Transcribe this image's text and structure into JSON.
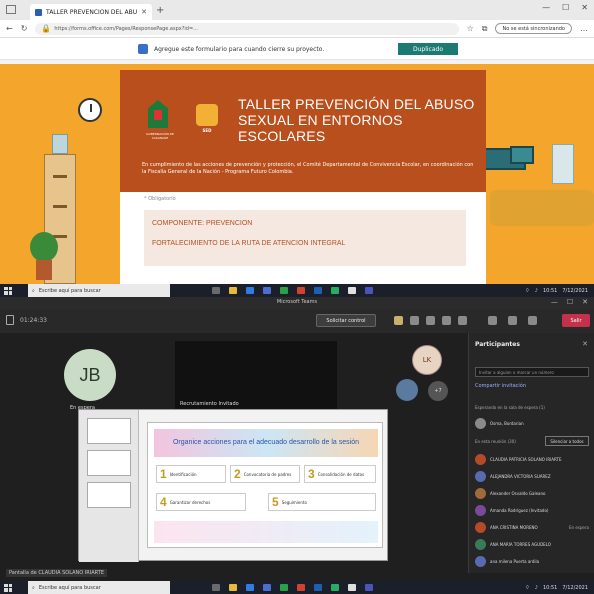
{
  "browser": {
    "tab_title": "TALLER PREVENCIÓN DEL ABU",
    "url": "https://forms.office.com/Pages/ResponsePage.aspx?id=...",
    "sync_label": "No se está sincronizando",
    "infobar_text": "Agregue este formulario para cuando cierre su proyecto.",
    "infobar_button": "Duplicado"
  },
  "form": {
    "title": "TALLER PREVENCIÓN DEL ABUSO SEXUAL EN ENTORNOS ESCOLARES",
    "description": "En cumplimiento de las acciones de prevención y protección, el Comité Departamental de Convivencia Escolar, en coordinación con la Fiscalía General de la Nación - Programa Futuro Colombia.",
    "logo1_caption": "GOBERNACIÓN DE CASANARE",
    "logo2_caption": "SED",
    "required_note": "* Obligatorio",
    "content_lines": [
      "COMPONENTE: PREVENCION",
      "FORTALECIMIENTO DE LA RUTA DE ATENCION INTEGRAL"
    ]
  },
  "taskbar": {
    "search_placeholder": "Escribe aquí para buscar",
    "time": "10:51",
    "date": "7/12/2021"
  },
  "teams": {
    "window_title": "Microsoft Teams",
    "timer": "01:24:33",
    "request_control": "Solicitar control",
    "leave": "Salir",
    "jb_initials": "JB",
    "waiting": "En espera",
    "video_name": "Recrutamiento Invitado",
    "lk_initials": "LK",
    "more_count": "+7",
    "share_caption": "Pantalla de CLAUDIA SOLANO IRIARTE",
    "slide_title": "Organice acciones para el adecuado desarrollo de la sesión",
    "steps": [
      {
        "num": "1",
        "text": "Identificación"
      },
      {
        "num": "2",
        "text": "Convocatoria de padres"
      },
      {
        "num": "3",
        "text": "Consolidación de datos"
      },
      {
        "num": "4",
        "text": "Garantizar derechos"
      },
      {
        "num": "5",
        "text": "Seguimiento"
      }
    ]
  },
  "participants": {
    "title": "Participantes",
    "search_placeholder": "Invitar a alguien o marcar un número",
    "share_link": "Compartir invitación",
    "lobby_header": "Esperando en la sala de espera (1)",
    "lobby_name": "Osma, Bordarian",
    "meeting_header": "En esta reunión (30)",
    "mute_all": "Silenciar a todos",
    "people": [
      {
        "name": "CLAUDIA PATRICIA SOLANO IRIARTE",
        "tag": "",
        "color": "#b44a2a"
      },
      {
        "name": "ALEJANDRA VICTORIA SUÁREZ",
        "tag": "",
        "color": "#5a6ab0"
      },
      {
        "name": "Alexander Osvaldo Galeano",
        "tag": "",
        "color": "#a06a3a"
      },
      {
        "name": "Amanda Rodríguez (Invitado)",
        "tag": "",
        "color": "#7a4a9a"
      },
      {
        "name": "ANA CRISTINA MORENO",
        "tag": "En espera",
        "color": "#b44a2a"
      },
      {
        "name": "ANA MARÍA TORRES AGUDELO",
        "tag": "",
        "color": "#3a7a5a"
      },
      {
        "name": "ana milena Puerta ardila",
        "tag": "",
        "color": "#5a6ab0"
      }
    ]
  }
}
